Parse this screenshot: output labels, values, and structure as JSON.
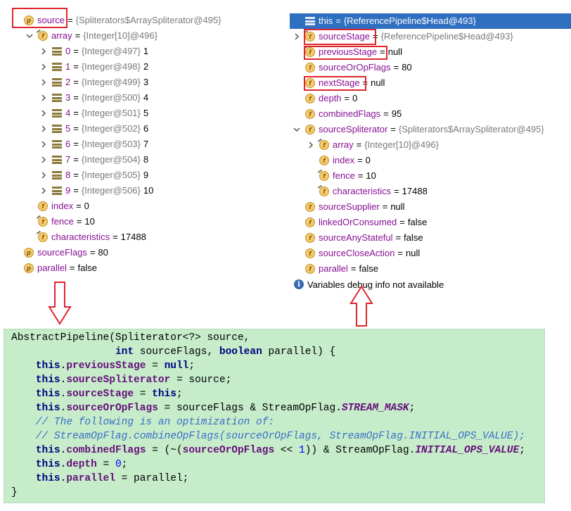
{
  "left_tree": [
    {
      "indent": 0,
      "chevron": "none",
      "icon": "p",
      "name": "source",
      "eq": "=",
      "ref": "{Spliterators$ArraySpliterator@495}",
      "val": ""
    },
    {
      "indent": 1,
      "chevron": "down",
      "icon": "f-final",
      "name": "array",
      "eq": "=",
      "ref": "{Integer[10]@496}",
      "val": ""
    },
    {
      "indent": 2,
      "chevron": "right",
      "icon": "arr",
      "name": "0",
      "eq": "=",
      "ref": "{Integer@497}",
      "val": "1"
    },
    {
      "indent": 2,
      "chevron": "right",
      "icon": "arr",
      "name": "1",
      "eq": "=",
      "ref": "{Integer@498}",
      "val": "2"
    },
    {
      "indent": 2,
      "chevron": "right",
      "icon": "arr",
      "name": "2",
      "eq": "=",
      "ref": "{Integer@499}",
      "val": "3"
    },
    {
      "indent": 2,
      "chevron": "right",
      "icon": "arr",
      "name": "3",
      "eq": "=",
      "ref": "{Integer@500}",
      "val": "4"
    },
    {
      "indent": 2,
      "chevron": "right",
      "icon": "arr",
      "name": "4",
      "eq": "=",
      "ref": "{Integer@501}",
      "val": "5"
    },
    {
      "indent": 2,
      "chevron": "right",
      "icon": "arr",
      "name": "5",
      "eq": "=",
      "ref": "{Integer@502}",
      "val": "6"
    },
    {
      "indent": 2,
      "chevron": "right",
      "icon": "arr",
      "name": "6",
      "eq": "=",
      "ref": "{Integer@503}",
      "val": "7"
    },
    {
      "indent": 2,
      "chevron": "right",
      "icon": "arr",
      "name": "7",
      "eq": "=",
      "ref": "{Integer@504}",
      "val": "8"
    },
    {
      "indent": 2,
      "chevron": "right",
      "icon": "arr",
      "name": "8",
      "eq": "=",
      "ref": "{Integer@505}",
      "val": "9"
    },
    {
      "indent": 2,
      "chevron": "right",
      "icon": "arr",
      "name": "9",
      "eq": "=",
      "ref": "{Integer@506}",
      "val": "10"
    },
    {
      "indent": 1,
      "chevron": "none",
      "icon": "f",
      "name": "index",
      "eq": "=",
      "ref": "",
      "val": "0"
    },
    {
      "indent": 1,
      "chevron": "none",
      "icon": "f-final",
      "name": "fence",
      "eq": "=",
      "ref": "",
      "val": "10"
    },
    {
      "indent": 1,
      "chevron": "none",
      "icon": "f-final",
      "name": "characteristics",
      "eq": "=",
      "ref": "",
      "val": "17488"
    },
    {
      "indent": 0,
      "chevron": "none",
      "icon": "p",
      "name": "sourceFlags",
      "eq": "=",
      "ref": "",
      "val": "80"
    },
    {
      "indent": 0,
      "chevron": "none",
      "icon": "p",
      "name": "parallel",
      "eq": "=",
      "ref": "",
      "val": "false"
    }
  ],
  "right_tree": [
    {
      "indent": 0,
      "chevron": "none",
      "icon": "this",
      "name": "this",
      "eq": "=",
      "ref": "{ReferencePipeline$Head@493}",
      "val": "",
      "selected": true
    },
    {
      "indent": 0,
      "chevron": "right",
      "icon": "f-final",
      "name": "sourceStage",
      "eq": "=",
      "ref": "{ReferencePipeline$Head@493}",
      "val": ""
    },
    {
      "indent": 0,
      "chevron": "none",
      "icon": "f-final",
      "name": "previousStage",
      "eq": "=",
      "ref": "",
      "val": "null"
    },
    {
      "indent": 0,
      "chevron": "none",
      "icon": "f",
      "name": "sourceOrOpFlags",
      "eq": "=",
      "ref": "",
      "val": "80"
    },
    {
      "indent": 0,
      "chevron": "none",
      "icon": "f",
      "name": "nextStage",
      "eq": "=",
      "ref": "",
      "val": "null"
    },
    {
      "indent": 0,
      "chevron": "none",
      "icon": "f",
      "name": "depth",
      "eq": "=",
      "ref": "",
      "val": "0"
    },
    {
      "indent": 0,
      "chevron": "none",
      "icon": "f",
      "name": "combinedFlags",
      "eq": "=",
      "ref": "",
      "val": "95"
    },
    {
      "indent": 0,
      "chevron": "down",
      "icon": "f",
      "name": "sourceSpliterator",
      "eq": "=",
      "ref": "{Spliterators$ArraySpliterator@495}",
      "val": ""
    },
    {
      "indent": 1,
      "chevron": "right",
      "icon": "f-final",
      "name": "array",
      "eq": "=",
      "ref": "{Integer[10]@496}",
      "val": ""
    },
    {
      "indent": 1,
      "chevron": "none",
      "icon": "f",
      "name": "index",
      "eq": "=",
      "ref": "",
      "val": "0"
    },
    {
      "indent": 1,
      "chevron": "none",
      "icon": "f-final",
      "name": "fence",
      "eq": "=",
      "ref": "",
      "val": "10"
    },
    {
      "indent": 1,
      "chevron": "none",
      "icon": "f-final",
      "name": "characteristics",
      "eq": "=",
      "ref": "",
      "val": "17488"
    },
    {
      "indent": 0,
      "chevron": "none",
      "icon": "f",
      "name": "sourceSupplier",
      "eq": "=",
      "ref": "",
      "val": "null"
    },
    {
      "indent": 0,
      "chevron": "none",
      "icon": "f",
      "name": "linkedOrConsumed",
      "eq": "=",
      "ref": "",
      "val": "false"
    },
    {
      "indent": 0,
      "chevron": "none",
      "icon": "f",
      "name": "sourceAnyStateful",
      "eq": "=",
      "ref": "",
      "val": "false"
    },
    {
      "indent": 0,
      "chevron": "none",
      "icon": "f",
      "name": "sourceCloseAction",
      "eq": "=",
      "ref": "",
      "val": "null"
    },
    {
      "indent": 0,
      "chevron": "none",
      "icon": "f",
      "name": "parallel",
      "eq": "=",
      "ref": "",
      "val": "false"
    }
  ],
  "debug_info_message": "Variables debug info not available",
  "code_lines": [
    [
      [
        "plain",
        "AbstractPipeline(Spliterator<?> source,"
      ]
    ],
    [
      [
        "plain",
        "                 "
      ],
      [
        "kw",
        "int"
      ],
      [
        "plain",
        " sourceFlags, "
      ],
      [
        "kw",
        "boolean"
      ],
      [
        "plain",
        " parallel) {"
      ]
    ],
    [
      [
        "plain",
        "    "
      ],
      [
        "kw",
        "this"
      ],
      [
        "plain",
        "."
      ],
      [
        "fld",
        "previousStage"
      ],
      [
        "plain",
        " = "
      ],
      [
        "kw",
        "null"
      ],
      [
        "plain",
        ";"
      ]
    ],
    [
      [
        "plain",
        "    "
      ],
      [
        "kw",
        "this"
      ],
      [
        "plain",
        "."
      ],
      [
        "fld",
        "sourceSpliterator"
      ],
      [
        "plain",
        " = source;"
      ]
    ],
    [
      [
        "plain",
        "    "
      ],
      [
        "kw",
        "this"
      ],
      [
        "plain",
        "."
      ],
      [
        "fld",
        "sourceStage"
      ],
      [
        "plain",
        " = "
      ],
      [
        "kw",
        "this"
      ],
      [
        "plain",
        ";"
      ]
    ],
    [
      [
        "plain",
        "    "
      ],
      [
        "kw",
        "this"
      ],
      [
        "plain",
        "."
      ],
      [
        "fld",
        "sourceOrOpFlags"
      ],
      [
        "plain",
        " = sourceFlags & StreamOpFlag."
      ],
      [
        "cst",
        "STREAM_MASK"
      ],
      [
        "plain",
        ";"
      ]
    ],
    [
      [
        "cmt",
        "    // The following is an optimization of:"
      ]
    ],
    [
      [
        "cmt",
        "    // StreamOpFlag.combineOpFlags(sourceOrOpFlags, StreamOpFlag.INITIAL_OPS_VALUE);"
      ]
    ],
    [
      [
        "plain",
        "    "
      ],
      [
        "kw",
        "this"
      ],
      [
        "plain",
        "."
      ],
      [
        "fld",
        "combinedFlags"
      ],
      [
        "plain",
        " = (~("
      ],
      [
        "fld",
        "sourceOrOpFlags"
      ],
      [
        "plain",
        " << "
      ],
      [
        "num",
        "1"
      ],
      [
        "plain",
        ")) & StreamOpFlag."
      ],
      [
        "cst",
        "INITIAL_OPS_VALUE"
      ],
      [
        "plain",
        ";"
      ]
    ],
    [
      [
        "plain",
        "    "
      ],
      [
        "kw",
        "this"
      ],
      [
        "plain",
        "."
      ],
      [
        "fld",
        "depth"
      ],
      [
        "plain",
        " = "
      ],
      [
        "num",
        "0"
      ],
      [
        "plain",
        ";"
      ]
    ],
    [
      [
        "plain",
        "    "
      ],
      [
        "kw",
        "this"
      ],
      [
        "plain",
        "."
      ],
      [
        "fld",
        "parallel"
      ],
      [
        "plain",
        " = parallel;"
      ]
    ],
    [
      [
        "plain",
        "}"
      ]
    ]
  ],
  "colors": {
    "highlight_red": "#e0252b",
    "selection_blue": "#2f6fbf",
    "code_background": "#c6ecca",
    "field_purple": "#871094"
  }
}
